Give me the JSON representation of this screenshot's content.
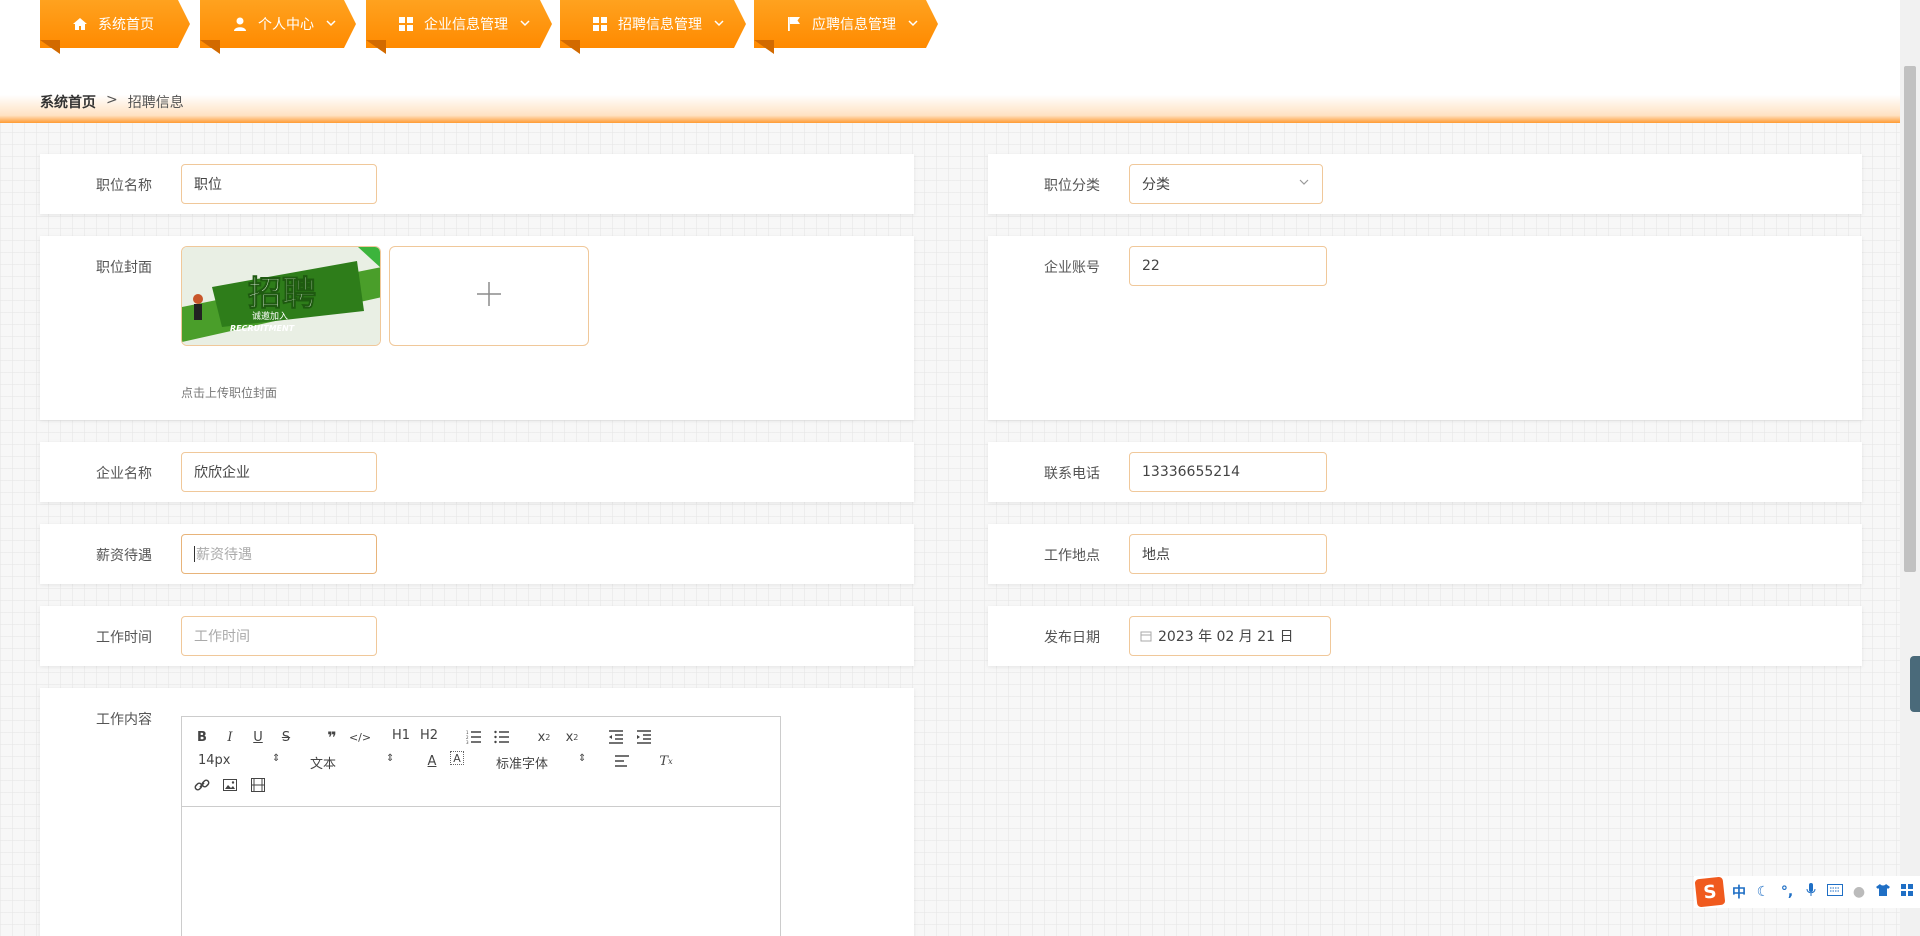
{
  "nav": {
    "items": [
      {
        "label": "系统首页",
        "icon": "home-icon",
        "has_caret": false
      },
      {
        "label": "个人中心",
        "icon": "user-icon",
        "has_caret": true
      },
      {
        "label": "企业信息管理",
        "icon": "grid-icon",
        "has_caret": true
      },
      {
        "label": "招聘信息管理",
        "icon": "grid-icon",
        "has_caret": true
      },
      {
        "label": "应聘信息管理",
        "icon": "flag-icon",
        "has_caret": true
      }
    ]
  },
  "breadcrumb": {
    "home": "系统首页",
    "separator": ">",
    "current": "招聘信息"
  },
  "form": {
    "job_name": {
      "label": "职位名称",
      "value": "职位"
    },
    "job_category": {
      "label": "职位分类",
      "value": "分类"
    },
    "job_cover": {
      "label": "职位封面",
      "tip": "点击上传职位封面",
      "thumb_title": "招聘",
      "thumb_subtitle": "诚邀加入",
      "thumb_en": "RECRUITMENT"
    },
    "company_account": {
      "label": "企业账号",
      "value": "22"
    },
    "company_name": {
      "label": "企业名称",
      "value": "欣欣企业"
    },
    "contact_phone": {
      "label": "联系电话",
      "value": "13336655214"
    },
    "salary": {
      "label": "薪资待遇",
      "placeholder": "薪资待遇"
    },
    "work_location": {
      "label": "工作地点",
      "value": "地点"
    },
    "work_time": {
      "label": "工作时间",
      "placeholder": "工作时间"
    },
    "publish_date": {
      "label": "发布日期",
      "value": "2023 年 02 月 21 日"
    },
    "job_content": {
      "label": "工作内容"
    }
  },
  "editor": {
    "font_size": "14px",
    "paragraph": "文本",
    "font_family": "标准字体",
    "h1": "H1",
    "h2": "H2"
  },
  "ime": {
    "lang": "中"
  },
  "colors": {
    "accent": "#ff8a00",
    "border": "#f0c89a"
  }
}
